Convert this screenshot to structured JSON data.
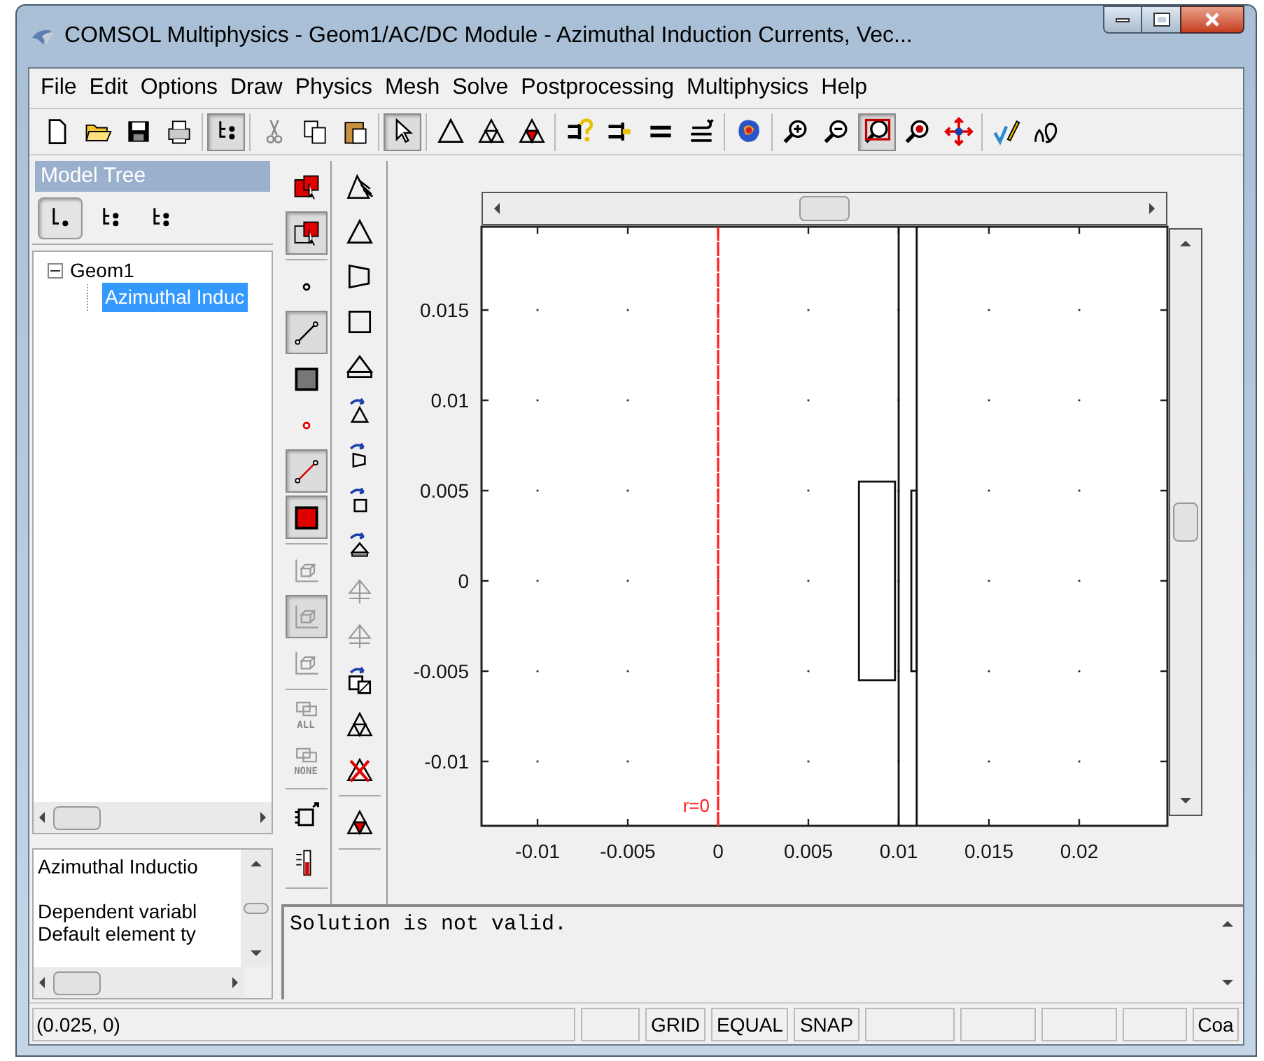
{
  "window": {
    "title": "COMSOL Multiphysics - Geom1/AC/DC Module - Azimuthal Induction Currents, Vec..."
  },
  "menu": [
    "File",
    "Edit",
    "Options",
    "Draw",
    "Physics",
    "Mesh",
    "Solve",
    "Postprocessing",
    "Multiphysics",
    "Help"
  ],
  "toolbar": [
    {
      "items": [
        {
          "kind": "page",
          "selected": false
        },
        {
          "kind": "folder",
          "selected": false
        },
        {
          "kind": "floppy",
          "selected": false
        },
        {
          "kind": "printer",
          "selected": false
        }
      ]
    },
    {
      "items": [
        {
          "kind": "tree",
          "selected": true
        }
      ]
    },
    {
      "items": [
        {
          "kind": "scissors",
          "selected": false
        },
        {
          "kind": "pages",
          "selected": false
        },
        {
          "kind": "clipboard",
          "selected": false
        }
      ]
    },
    {
      "items": [
        {
          "kind": "pointer",
          "selected": true
        }
      ]
    },
    {
      "items": [
        {
          "kind": "triangle",
          "selected": false
        },
        {
          "kind": "triangle-mesh",
          "selected": false
        },
        {
          "kind": "triangle-filled",
          "selected": false
        }
      ]
    },
    {
      "items": [
        {
          "kind": "question-bracket",
          "selected": false
        },
        {
          "kind": "bracket",
          "selected": false
        },
        {
          "kind": "equals",
          "selected": false
        },
        {
          "kind": "stack-arrow",
          "selected": false
        }
      ]
    },
    {
      "items": [
        {
          "kind": "color-blob",
          "selected": false
        }
      ]
    },
    {
      "items": [
        {
          "kind": "zoom-in",
          "selected": false
        },
        {
          "kind": "zoom-out",
          "selected": false
        },
        {
          "kind": "zoom-window",
          "selected": true
        },
        {
          "kind": "zoom-extents",
          "selected": false
        },
        {
          "kind": "move-arrows",
          "selected": false
        }
      ]
    },
    {
      "items": [
        {
          "kind": "pencil-check",
          "selected": false
        },
        {
          "kind": "omega",
          "selected": false
        }
      ]
    }
  ],
  "model_tree": {
    "title": "Model Tree",
    "views": [
      {
        "kind": "tree-flat",
        "selected": true
      },
      {
        "kind": "tree-dots",
        "selected": false
      },
      {
        "kind": "tree-dots-x",
        "selected": false
      }
    ],
    "nodes": [
      {
        "label": "Geom1",
        "expanded": true,
        "selected": false,
        "children": [
          {
            "label": "Azimuthal Induc",
            "selected": true
          }
        ]
      }
    ]
  },
  "info_panel": {
    "lines": [
      "Azimuthal Inductio",
      "Dependent variabl",
      "Default element ty"
    ]
  },
  "draw_tools": [
    [
      {
        "kind": "boxes-cursor",
        "selected": false,
        "disabled": false
      },
      {
        "kind": "box-outline-cursor",
        "selected": true,
        "disabled": false
      }
    ],
    [
      {
        "kind": "point",
        "selected": false,
        "disabled": false
      },
      {
        "kind": "line",
        "selected": true,
        "disabled": false
      },
      {
        "kind": "filled-square",
        "selected": false,
        "disabled": false
      },
      {
        "kind": "point-marker",
        "selected": false,
        "disabled": false
      },
      {
        "kind": "line-segment",
        "selected": true,
        "disabled": false
      },
      {
        "kind": "solid-square",
        "selected": true,
        "disabled": false
      }
    ],
    [
      {
        "kind": "axis-box",
        "selected": false,
        "disabled": true
      },
      {
        "kind": "axis-box",
        "selected": true,
        "disabled": true
      },
      {
        "kind": "axis-box",
        "selected": false,
        "disabled": true
      }
    ],
    [
      {
        "kind": "group-select",
        "label": "ALL",
        "selected": false,
        "disabled": true
      },
      {
        "kind": "group-select",
        "label": "NONE",
        "selected": false,
        "disabled": true
      }
    ],
    [
      {
        "kind": "export-box",
        "selected": false,
        "disabled": false
      },
      {
        "kind": "thermometer",
        "selected": false,
        "disabled": false
      }
    ]
  ],
  "shape_tools": [
    [
      {
        "kind": "hatched-triangle",
        "disabled": false
      },
      {
        "kind": "triangle",
        "disabled": false
      },
      {
        "kind": "polygon",
        "disabled": false
      },
      {
        "kind": "square",
        "disabled": false
      },
      {
        "kind": "base-triangle",
        "disabled": false
      },
      {
        "kind": "rotate-triangle",
        "disabled": false
      },
      {
        "kind": "rotate-polygon",
        "disabled": false
      },
      {
        "kind": "rotate-square",
        "disabled": false
      },
      {
        "kind": "rotate-base",
        "disabled": false
      },
      {
        "kind": "split-triangle",
        "disabled": true
      },
      {
        "kind": "split-triangle",
        "disabled": true
      },
      {
        "kind": "rotate-split",
        "disabled": false
      },
      {
        "kind": "triangle-mesh",
        "disabled": false
      },
      {
        "kind": "crossed-triangle",
        "disabled": false
      }
    ],
    [
      {
        "kind": "triangle-filled",
        "disabled": false
      }
    ]
  ],
  "canvas": {
    "x_ticks": [
      "-0.01",
      "-0.005",
      "0",
      "0.005",
      "0.01",
      "0.015",
      "0.02"
    ],
    "y_ticks": [
      "0.015",
      "0.01",
      "0.005",
      "0",
      "-0.005",
      "-0.01"
    ],
    "axis_label": "r=0"
  },
  "log": {
    "text": "Solution is not valid."
  },
  "status_bar": {
    "coordinates": "(0.025, 0)",
    "toggles": [
      "GRID",
      "EQUAL",
      "SNAP"
    ],
    "last": "Coa"
  }
}
